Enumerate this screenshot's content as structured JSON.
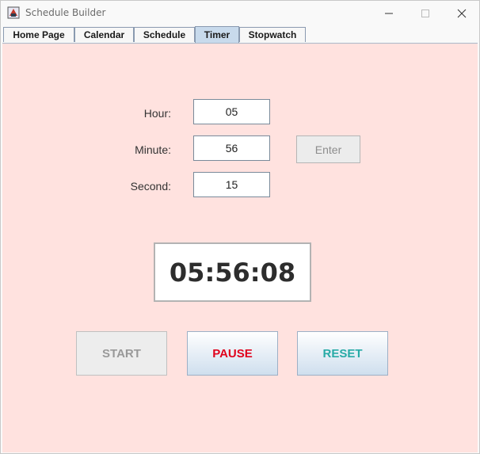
{
  "window": {
    "title": "Schedule Builder"
  },
  "tabs": [
    {
      "label": "Home Page"
    },
    {
      "label": "Calendar"
    },
    {
      "label": "Schedule"
    },
    {
      "label": "Timer",
      "active": true
    },
    {
      "label": "Stopwatch"
    }
  ],
  "timer": {
    "hour_label": "Hour:",
    "minute_label": "Minute:",
    "second_label": "Second:",
    "hour_value": "05",
    "minute_value": "56",
    "second_value": "15",
    "enter_label": "Enter",
    "display": "05:56:08",
    "start_label": "START",
    "pause_label": "PAUSE",
    "reset_label": "RESET"
  },
  "colors": {
    "background": "#ffe2df",
    "pause_text": "#e0001b",
    "reset_text": "#27aaa6",
    "active_tab": "#c8daec"
  }
}
